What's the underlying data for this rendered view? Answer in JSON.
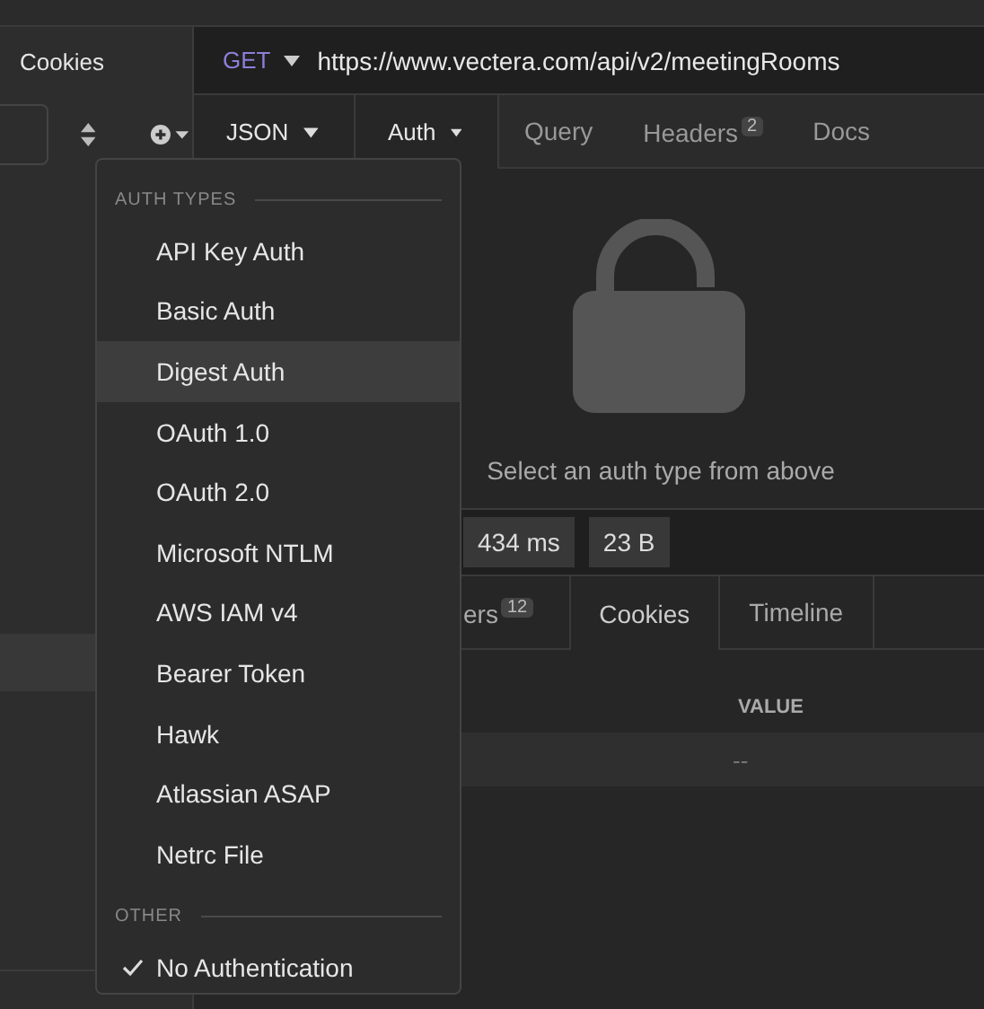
{
  "sidebar": {
    "title": "Cookies",
    "highlighted_row": true
  },
  "request": {
    "method": "GET",
    "url": "https://www.vectera.com/api/v2/meetingRooms",
    "body_type": "JSON",
    "tabs": [
      {
        "label": "Auth",
        "kind": "dropdown",
        "selected": true
      },
      {
        "label": "Query",
        "kind": "tab",
        "selected": false
      },
      {
        "label": "Headers",
        "kind": "tab",
        "badge": "2",
        "selected": false
      },
      {
        "label": "Docs",
        "kind": "tab",
        "selected": false
      }
    ]
  },
  "auth_panel": {
    "message": "Select an auth type from above"
  },
  "response": {
    "stats": [
      "434 ms",
      "23 B"
    ],
    "tabs": [
      {
        "label": "ers",
        "badge": "12",
        "selected": false
      },
      {
        "label": "Cookies",
        "selected": true
      },
      {
        "label": "Timeline",
        "selected": false
      }
    ],
    "table": {
      "columns": [
        "VALUE"
      ],
      "rows": [
        [
          "--"
        ]
      ]
    }
  },
  "auth_menu": {
    "sections": [
      {
        "title": "AUTH TYPES",
        "items": [
          {
            "label": "API Key Auth",
            "checked": false,
            "highlighted": false
          },
          {
            "label": "Basic Auth",
            "checked": false,
            "highlighted": false
          },
          {
            "label": "Digest Auth",
            "checked": false,
            "highlighted": true
          },
          {
            "label": "OAuth 1.0",
            "checked": false,
            "highlighted": false
          },
          {
            "label": "OAuth 2.0",
            "checked": false,
            "highlighted": false
          },
          {
            "label": "Microsoft NTLM",
            "checked": false,
            "highlighted": false
          },
          {
            "label": "AWS IAM v4",
            "checked": false,
            "highlighted": false
          },
          {
            "label": "Bearer Token",
            "checked": false,
            "highlighted": false
          },
          {
            "label": "Hawk",
            "checked": false,
            "highlighted": false
          },
          {
            "label": "Atlassian ASAP",
            "checked": false,
            "highlighted": false
          },
          {
            "label": "Netrc File",
            "checked": false,
            "highlighted": false
          }
        ]
      },
      {
        "title": "OTHER",
        "items": [
          {
            "label": "No Authentication",
            "checked": true,
            "highlighted": false
          }
        ]
      }
    ]
  }
}
